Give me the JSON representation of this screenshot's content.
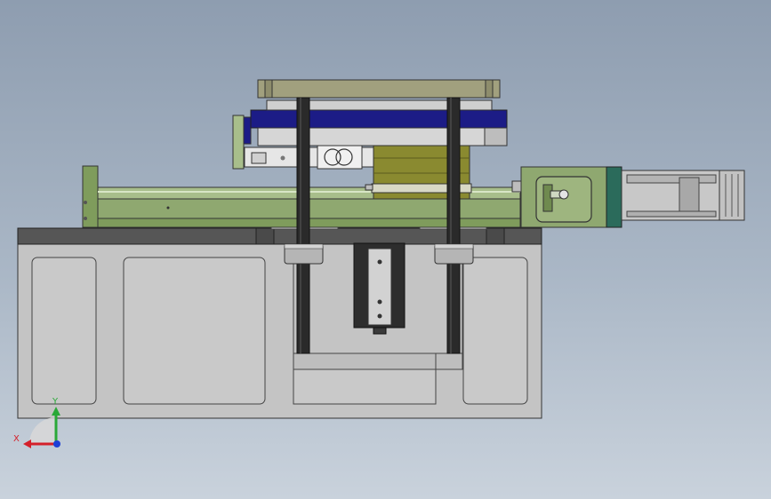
{
  "viewport": {
    "background_top": "#8e9db0",
    "background_bottom": "#c9d2dc"
  },
  "triad": {
    "x_label": "X",
    "y_label": "Y",
    "x_color": "#d4202a",
    "y_color": "#2aa838",
    "z_color": "#1d3fd6"
  },
  "parts": {
    "frame_color": "#c4c4c4",
    "top_plate_color": "#565656",
    "rail_color": "#8fa870",
    "carriage_color": "#1c1c86",
    "motor_color": "#c8c8c8",
    "motor_block_color": "#2b6b5b",
    "bearing_color": "#b5b5b5",
    "column_color": "#2a2a2a",
    "yellow_block_color": "#8a8a30"
  }
}
